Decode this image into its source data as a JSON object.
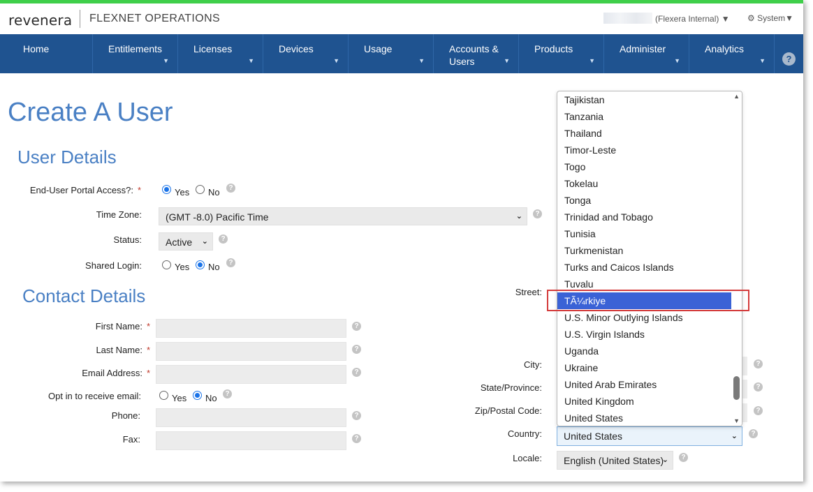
{
  "header": {
    "logo_text": "revenera",
    "product_name": "FLEXNET OPERATIONS",
    "user_org": "(Flexera Internal) ▼",
    "system_menu": "System▼"
  },
  "nav": {
    "items": [
      {
        "label": "Home",
        "caret": ""
      },
      {
        "label": "Entitlements",
        "caret": "▼"
      },
      {
        "label": "Licenses",
        "caret": "▼"
      },
      {
        "label": "Devices",
        "caret": "▼"
      },
      {
        "label": "Usage",
        "caret": "▼"
      },
      {
        "label": "Accounts &",
        "label2": "Users",
        "caret": "▼"
      },
      {
        "label": "Products",
        "caret": "▼"
      },
      {
        "label": "Administer",
        "caret": "▼"
      },
      {
        "label": "Analytics",
        "caret": "▼"
      }
    ],
    "help": "?"
  },
  "page": {
    "title": "Create A User"
  },
  "user_details": {
    "title": "User Details",
    "portal_access_label": "End-User Portal Access?:",
    "portal_access_yes": "Yes",
    "portal_access_no": "No",
    "time_zone_label": "Time Zone:",
    "time_zone_value": "(GMT -8.0) Pacific Time",
    "status_label": "Status:",
    "status_value": "Active",
    "shared_login_label": "Shared Login:",
    "shared_login_yes": "Yes",
    "shared_login_no": "No"
  },
  "contact_details": {
    "title": "Contact Details",
    "first_name_label": "First Name:",
    "last_name_label": "Last Name:",
    "email_label": "Email Address:",
    "opt_in_label": "Opt in to receive email:",
    "opt_in_yes": "Yes",
    "opt_in_no": "No",
    "phone_label": "Phone:",
    "fax_label": "Fax:",
    "required_mark": "*"
  },
  "address": {
    "street_label": "Street:",
    "city_label": "City:",
    "state_label": "State/Province:",
    "zip_label": "Zip/Postal Code:",
    "country_label": "Country:",
    "country_value": "United States",
    "locale_label": "Locale:",
    "locale_value": "English (United States)"
  },
  "country_dropdown": {
    "options": [
      "Tajikistan",
      "Tanzania",
      "Thailand",
      "Timor-Leste",
      "Togo",
      "Tokelau",
      "Tonga",
      "Trinidad and Tobago",
      "Tunisia",
      "Turkmenistan",
      "Turks and Caicos Islands",
      "Tuvalu",
      "TÃ¼rkiye",
      "U.S. Minor Outlying Islands",
      "U.S. Virgin Islands",
      "Uganda",
      "Ukraine",
      "United Arab Emirates",
      "United Kingdom",
      "United States"
    ],
    "selected_index": 12
  },
  "colors": {
    "accent_green": "#3fcf4a",
    "nav_blue": "#1f5390",
    "heading_blue": "#4a80c4",
    "selected_option": "#3a62d6",
    "highlight_red": "#d43b3b"
  }
}
